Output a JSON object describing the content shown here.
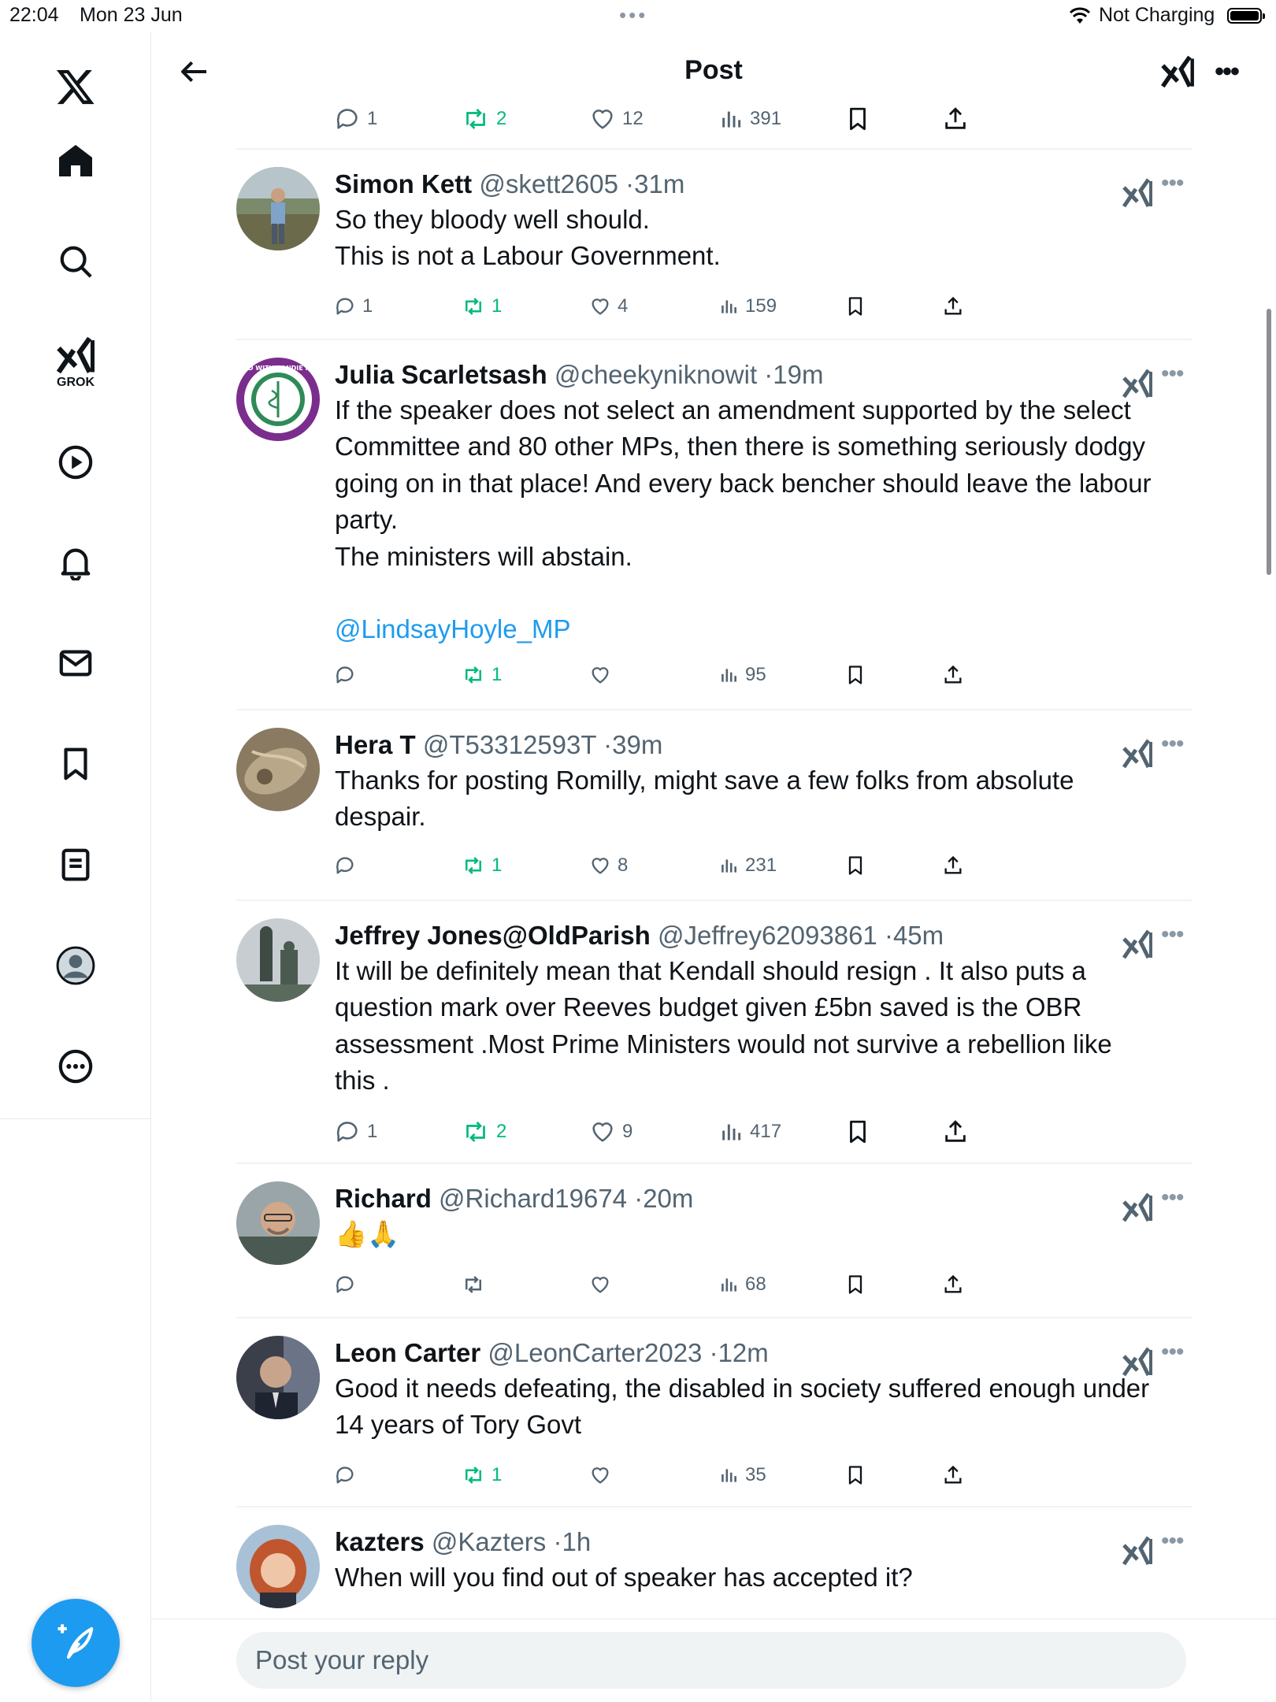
{
  "status_bar": {
    "time": "22:04",
    "date": "Mon 23 Jun",
    "charging": "Not Charging"
  },
  "sidebar": {
    "grok_label": "GROK"
  },
  "header": {
    "title": "Post"
  },
  "top_actions": {
    "replies": "1",
    "reposts": "2",
    "likes": "12",
    "views": "391"
  },
  "replies": [
    {
      "name": "Simon Kett",
      "handle": "@skett2605",
      "time": "31m",
      "lines": [
        "So they bloody well should.",
        "This is not a Labour Government."
      ],
      "stats": {
        "replies": "1",
        "reposts": "1",
        "likes": "4",
        "views": "159"
      }
    },
    {
      "name": "Julia Scarletsash",
      "handle": "@cheekyniknowit",
      "time": "19m",
      "lines": [
        "If the speaker does not select an amendment supported by the select",
        "Committee and 80 other MPs, then there is something seriously dodgy",
        "going on in that place! And every back bencher should leave the labour",
        "party.",
        "The ministers will abstain."
      ],
      "mention": "@LindsayHoyle_MP",
      "stats": {
        "replies": "",
        "reposts": "1",
        "likes": "",
        "views": "95"
      }
    },
    {
      "name": "Hera T",
      "handle": "@T53312593T",
      "time": "39m",
      "lines": [
        "Thanks for posting Romilly, might save a few folks from absolute",
        "despair."
      ],
      "stats": {
        "replies": "",
        "reposts": "1",
        "likes": "8",
        "views": "231"
      }
    },
    {
      "name": "Jeffrey Jones@OldParish",
      "handle": "@Jeffrey62093861",
      "time": "45m",
      "lines": [
        "It will be definitely mean that Kendall should resign . It also puts a",
        "question mark over Reeves budget given £5bn saved is the OBR",
        "assessment .Most Prime Ministers  would not survive a rebellion like",
        "this ."
      ],
      "stats": {
        "replies": "1",
        "reposts": "2",
        "likes": "9",
        "views": "417"
      }
    },
    {
      "name": "Richard",
      "handle": "@Richard19674",
      "time": "20m",
      "lines": [
        "👍🙏"
      ],
      "stats": {
        "replies": "",
        "reposts": "",
        "likes": "",
        "views": "68"
      }
    },
    {
      "name": "Leon Carter",
      "handle": "@LeonCarter2023",
      "time": "12m",
      "lines": [
        "Good it needs defeating, the disabled in society suffered enough under",
        "14 years of Tory Govt"
      ],
      "stats": {
        "replies": "",
        "reposts": "1",
        "likes": "",
        "views": "35"
      }
    },
    {
      "name": "kazters",
      "handle": "@Kazters",
      "time": "1h",
      "lines": [
        "When will you find out of speaker has accepted it?"
      ]
    }
  ],
  "avatar_badge_text": "I STAND WITH SANDIE PEGGIE",
  "reply_bar": {
    "placeholder": "Post your reply"
  },
  "colors": {
    "accent": "#1d9bf0",
    "repost_green": "#00ba7c",
    "secondary_text": "#536471"
  }
}
